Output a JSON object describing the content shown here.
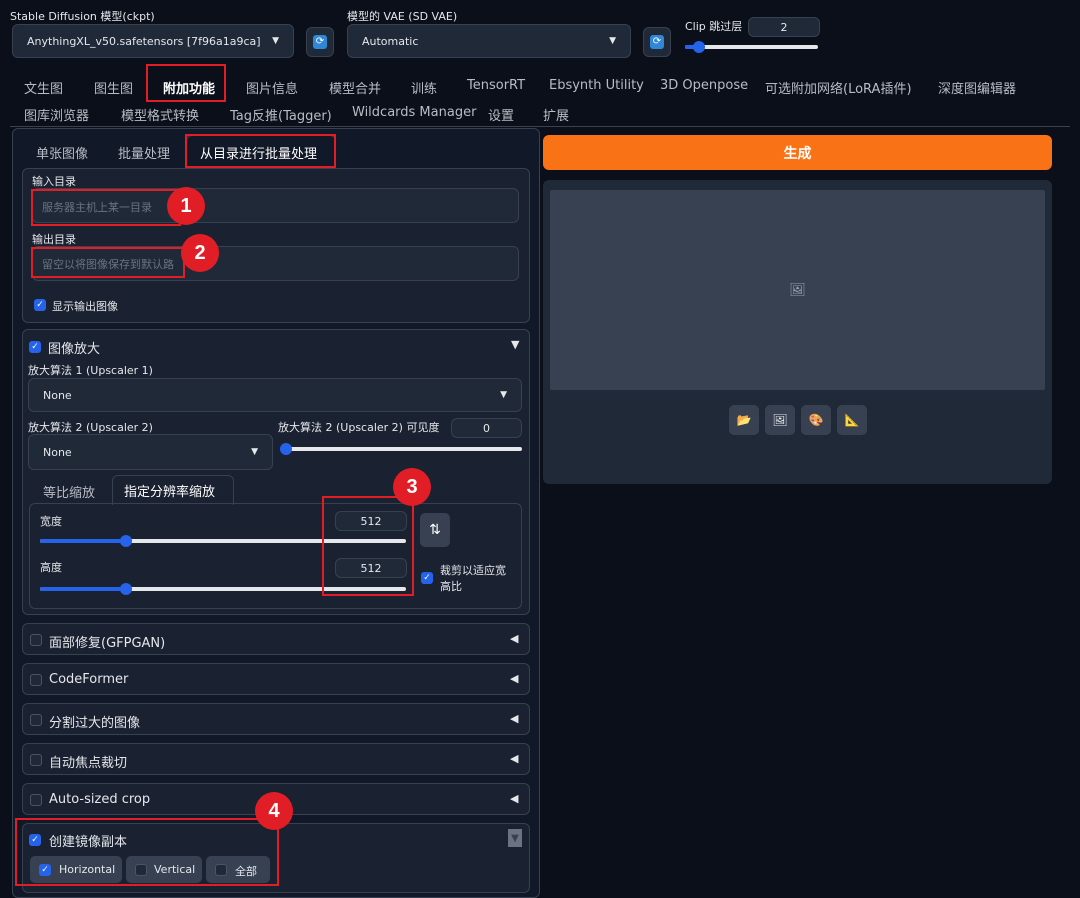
{
  "top": {
    "model_label": "Stable Diffusion 模型(ckpt)",
    "model_value": "AnythingXL_v50.safetensors [7f96a1a9ca]",
    "vae_label": "模型的 VAE (SD VAE)",
    "vae_value": "Automatic",
    "clip_label": "Clip 跳过层",
    "clip_value": "2",
    "clip_slider_level": 0.1
  },
  "tabs_row1": [
    "文生图",
    "图生图",
    "附加功能",
    "图片信息",
    "模型合并",
    "训练",
    "TensorRT",
    "Ebsynth Utility",
    "3D Openpose",
    "可选附加网络(LoRA插件)",
    "深度图编辑器"
  ],
  "tabs_row2": [
    "图库浏览器",
    "模型格式转换",
    "Tag反推(Tagger)",
    "Wildcards Manager",
    "设置",
    "扩展"
  ],
  "subtabs": [
    "单张图像",
    "批量处理",
    "从目录进行批量处理"
  ],
  "input_dir": {
    "label": "输入目录",
    "placeholder": "服务器主机上某一目录"
  },
  "output_dir": {
    "label": "输出目录",
    "placeholder": "留空以将图像保存到默认路"
  },
  "show_output": {
    "label": "显示输出图像",
    "checked": true
  },
  "upscale": {
    "title": "图像放大",
    "arrow": "▼",
    "upscaler1_label": "放大算法 1 (Upscaler 1)",
    "upscaler1_value": "None",
    "upscaler2_label": "放大算法 2 (Upscaler 2)",
    "upscaler2_value": "None",
    "visibility_label": "放大算法 2 (Upscaler 2) 可见度",
    "visibility_value": "0",
    "scale_tabs": [
      "等比缩放",
      "指定分辨率缩放"
    ],
    "width_label": "宽度",
    "width_value": "512",
    "height_label": "高度",
    "height_value": "512",
    "swap_icon": "⇅",
    "crop_label": "裁剪以适应宽高比"
  },
  "accordions": [
    {
      "title": "面部修复(GFPGAN)",
      "arrow": "◀"
    },
    {
      "title": "CodeFormer",
      "arrow": "◀"
    },
    {
      "title": "分割过大的图像",
      "arrow": "◀"
    },
    {
      "title": "自动焦点裁切",
      "arrow": "◀"
    },
    {
      "title": "Auto-sized crop",
      "arrow": "◀"
    }
  ],
  "mirror": {
    "title": "创建镜像副本",
    "options": [
      {
        "label": "Horizontal",
        "checked": true
      },
      {
        "label": "Vertical",
        "checked": false
      },
      {
        "label": "全部",
        "checked": false
      }
    ]
  },
  "generate_label": "生成",
  "image_icon": "🖼",
  "tools": [
    "📂",
    "🖼",
    "🎨",
    "📐"
  ],
  "badges": [
    "1",
    "2",
    "3",
    "4"
  ],
  "colors": {
    "accent": "#2563eb",
    "generate": "#f97316",
    "annotation": "#e11d26"
  }
}
